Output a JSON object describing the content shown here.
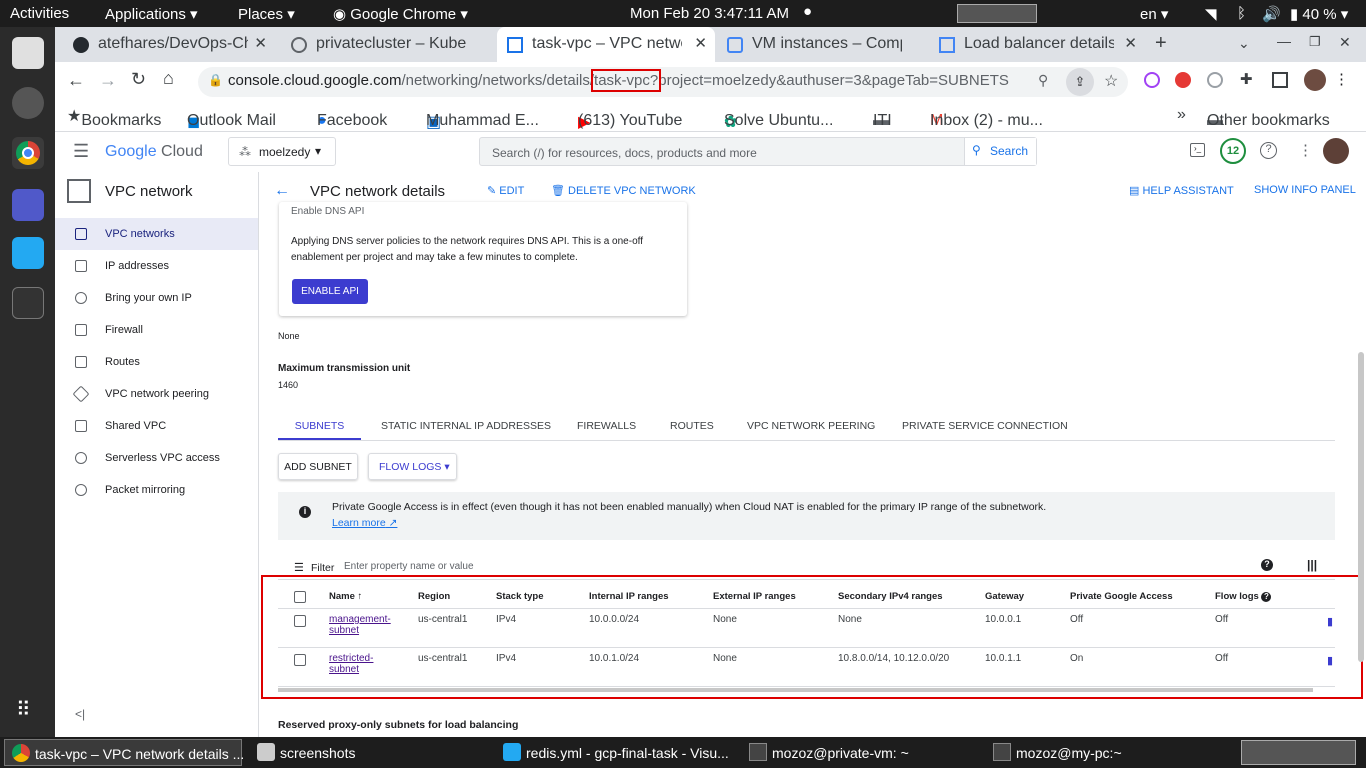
{
  "topbar": {
    "activities": "Activities",
    "applications": "Applications",
    "places": "Places",
    "app": "Google Chrome",
    "clock": "Mon Feb 20  3:47:11 AM",
    "lang": "en",
    "battery": "40 %"
  },
  "tabs": [
    {
      "label": "atefhares/DevOps-Ch"
    },
    {
      "label": "privatecluster – Kube"
    },
    {
      "label": "task-vpc – VPC netwo"
    },
    {
      "label": "VM instances – Comp"
    },
    {
      "label": "Load balancer details"
    }
  ],
  "url": {
    "host": "console.cloud.google.com",
    "path": "/networking/networks/details/",
    "highlight": "task-vpc?",
    "rest": "project=moelzedy&authuser=3&pageTab=SUBNETS"
  },
  "bookmarks": [
    "Bookmarks",
    "Outlook Mail",
    "Facebook",
    "Muhammad E...",
    "(613) YouTube",
    "Solve Ubuntu...",
    "ITI",
    "Inbox (2) - mu...",
    "Other bookmarks"
  ],
  "gc": {
    "logo_google": "Google",
    "logo_cloud": " Cloud",
    "project": "moelzedy",
    "search_placeholder": "Search (/) for resources, docs, products and more",
    "search_btn": "Search",
    "notif_count": "12"
  },
  "nav": {
    "title": "VPC network",
    "items": [
      "VPC networks",
      "IP addresses",
      "Bring your own IP",
      "Firewall",
      "Routes",
      "VPC network peering",
      "Shared VPC",
      "Serverless VPC access",
      "Packet mirroring"
    ]
  },
  "header": {
    "title": "VPC network details",
    "edit": "EDIT",
    "delete": "DELETE VPC NETWORK",
    "help": "HELP ASSISTANT",
    "info": "SHOW INFO PANEL"
  },
  "card": {
    "cut": "Enable DNS API",
    "text1": "Applying DNS server policies to the network requires DNS API. This is a one-off",
    "text2": "enablement per project and may take a few minutes to complete.",
    "button": "ENABLE API"
  },
  "fields": {
    "none": "None",
    "mtu_label": "Maximum transmission unit",
    "mtu": "1460"
  },
  "subtabs": [
    "SUBNETS",
    "STATIC INTERNAL IP ADDRESSES",
    "FIREWALLS",
    "ROUTES",
    "VPC NETWORK PEERING",
    "PRIVATE SERVICE CONNECTION"
  ],
  "actions": {
    "add": "ADD SUBNET",
    "flow": "FLOW LOGS"
  },
  "info": {
    "text": "Private Google Access is in effect (even though it has not been enabled manually) when Cloud NAT is enabled for the primary IP range of the subnetwork.",
    "link": "Learn more"
  },
  "filter": {
    "label": "Filter",
    "placeholder": "Enter property name or value"
  },
  "table": {
    "headers": [
      "Name",
      "Region",
      "Stack type",
      "Internal IP ranges",
      "External IP ranges",
      "Secondary IPv4 ranges",
      "Gateway",
      "Private Google Access",
      "Flow logs"
    ],
    "rows": [
      {
        "name1": "management-",
        "name2": "subnet",
        "region": "us-central1",
        "stack": "IPv4",
        "internal": "10.0.0.0/24",
        "external": "None",
        "secondary": "None",
        "gateway": "10.0.0.1",
        "pga": "Off",
        "flow": "Off"
      },
      {
        "name1": "restricted-",
        "name2": "subnet",
        "region": "us-central1",
        "stack": "IPv4",
        "internal": "10.0.1.0/24",
        "external": "None",
        "secondary": "10.8.0.0/14, 10.12.0.0/20",
        "gateway": "10.0.1.1",
        "pga": "On",
        "flow": "Off"
      }
    ]
  },
  "reserved": "Reserved proxy-only subnets for load balancing",
  "taskbar": [
    "task-vpc – VPC network details ...",
    "screenshots",
    "redis.yml - gcp-final-task - Visu...",
    "mozoz@private-vm: ~",
    "mozoz@my-pc:~"
  ]
}
